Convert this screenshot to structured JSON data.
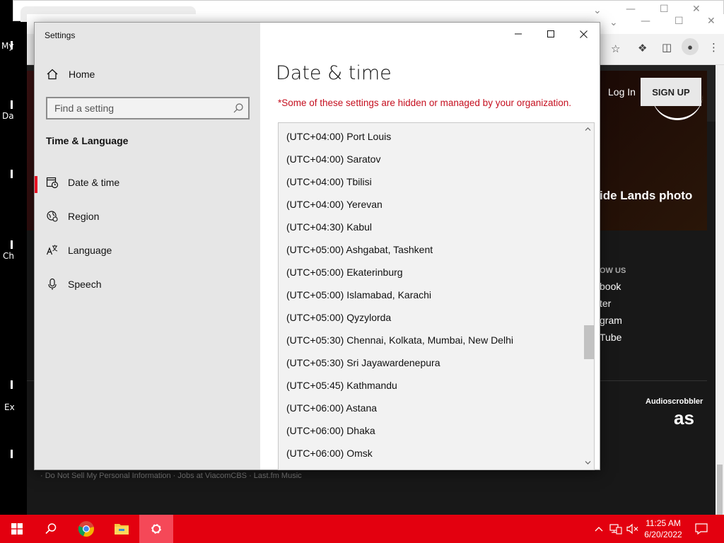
{
  "desktop": {
    "labels": [
      "My",
      "Da",
      "Ch",
      "Ex"
    ]
  },
  "background_browser": {
    "nav": {
      "login": "Log In",
      "signup": "SIGN UP"
    },
    "hero_text": "ide Lands photo",
    "follow": {
      "heading": "OW US",
      "links": [
        "book",
        "ter",
        "gram",
        "Tube"
      ]
    },
    "brand": {
      "label": "Audioscrobbler",
      "logo": "as"
    },
    "footer_links": "· Do Not Sell My Personal Information · Jobs at ViacomCBS · Last.fm Music"
  },
  "settings": {
    "window_title": "Settings",
    "sidebar": {
      "home_label": "Home",
      "search_placeholder": "Find a setting",
      "section_title": "Time & Language",
      "items": [
        {
          "label": "Date & time",
          "icon": "calendar-clock-icon",
          "active": true
        },
        {
          "label": "Region",
          "icon": "globe-icon",
          "active": false
        },
        {
          "label": "Language",
          "icon": "language-icon",
          "active": false
        },
        {
          "label": "Speech",
          "icon": "microphone-icon",
          "active": false
        }
      ]
    },
    "main": {
      "title": "Date & time",
      "managed_notice": "*Some of these settings are hidden or managed by your organization.",
      "timezones": [
        "(UTC+04:00) Port Louis",
        "(UTC+04:00) Saratov",
        "(UTC+04:00) Tbilisi",
        "(UTC+04:00) Yerevan",
        "(UTC+04:30) Kabul",
        "(UTC+05:00) Ashgabat, Tashkent",
        "(UTC+05:00) Ekaterinburg",
        "(UTC+05:00) Islamabad, Karachi",
        "(UTC+05:00) Qyzylorda",
        "(UTC+05:30) Chennai, Kolkata, Mumbai, New Delhi",
        "(UTC+05:30) Sri Jayawardenepura",
        "(UTC+05:45) Kathmandu",
        "(UTC+06:00) Astana",
        "(UTC+06:00) Dhaka",
        "(UTC+06:00) Omsk"
      ]
    }
  },
  "taskbar": {
    "apps": [
      "start-icon",
      "search-icon",
      "chrome-icon",
      "file-explorer-icon",
      "settings-gear-icon"
    ],
    "clock": {
      "time": "11:25 AM",
      "date": "6/20/2022"
    },
    "accent": "#e3000f"
  }
}
